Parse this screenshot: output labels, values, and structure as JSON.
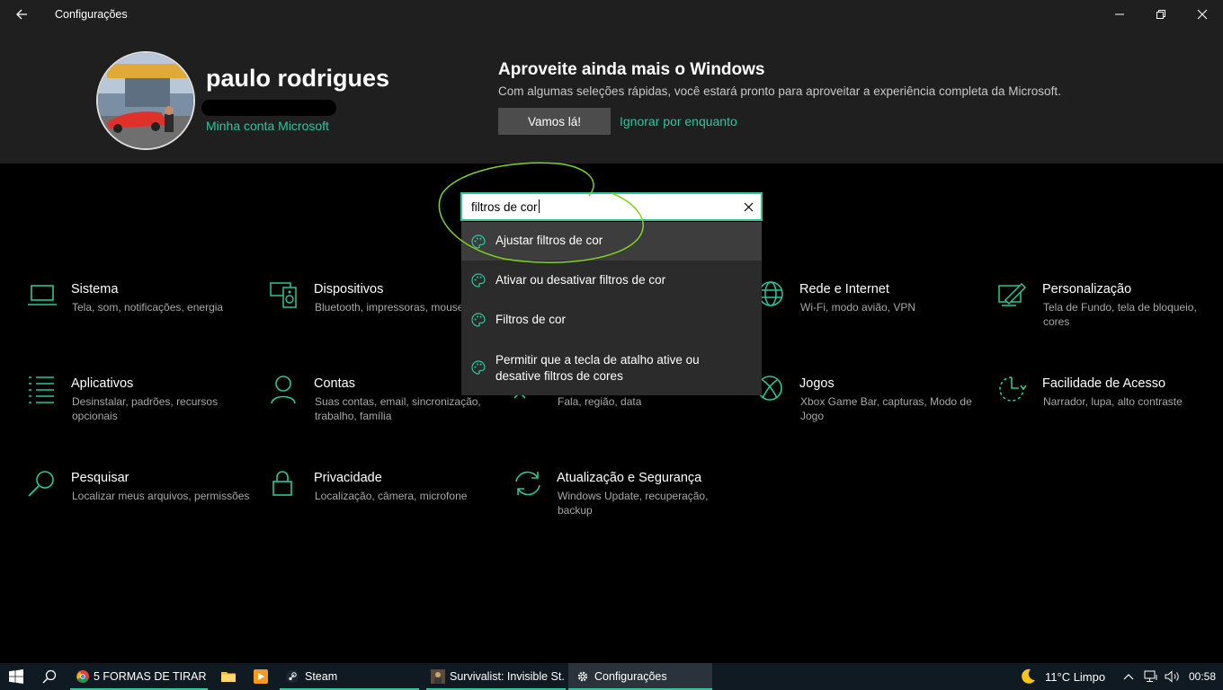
{
  "window": {
    "title": "Configurações",
    "back_icon": "arrow-left-icon",
    "controls": [
      "minimize-icon",
      "maximize-icon",
      "close-icon"
    ]
  },
  "account": {
    "name": "paulo rodrigues",
    "link": "Minha conta Microsoft"
  },
  "promo": {
    "title": "Aproveite ainda mais o Windows",
    "text": "Com algumas seleções rápidas, você estará pronto para aproveitar a experiência completa da Microsoft.",
    "primary_button": "Vamos lá!",
    "secondary_link": "Ignorar por enquanto"
  },
  "search": {
    "value": "filtros de cor",
    "clear_icon": "close-icon",
    "suggestions": [
      {
        "label": "Ajustar filtros de cor",
        "icon": "palette-icon"
      },
      {
        "label": "Ativar ou desativar filtros de cor",
        "icon": "palette-icon"
      },
      {
        "label": "Filtros de cor",
        "icon": "palette-icon"
      },
      {
        "label": "Permitir que a tecla de atalho ative ou desative filtros de cores",
        "icon": "palette-icon"
      }
    ]
  },
  "categories": [
    {
      "title": "Sistema",
      "desc": "Tela, som, notificações, energia",
      "icon": "laptop-icon"
    },
    {
      "title": "Dispositivos",
      "desc": "Bluetooth, impressoras, mouse",
      "icon": "devices-icon"
    },
    {
      "title": "Rede e Internet",
      "desc": "Wi-Fi, modo avião, VPN",
      "icon": "globe-icon"
    },
    {
      "title": "Personalização",
      "desc": "Tela de Fundo, tela de bloqueio, cores",
      "icon": "paint-icon"
    },
    {
      "title": "Aplicativos",
      "desc": "Desinstalar, padrões, recursos opcionais",
      "icon": "apps-list-icon"
    },
    {
      "title": "Contas",
      "desc": "Suas contas, email, sincronização, trabalho, família",
      "icon": "person-icon"
    },
    {
      "title": "",
      "desc": "Fala, região, data",
      "icon": "language-icon"
    },
    {
      "title": "Jogos",
      "desc": "Xbox Game Bar, capturas, Modo de Jogo",
      "icon": "xbox-icon"
    },
    {
      "title": "Facilidade de Acesso",
      "desc": "Narrador, lupa, alto contraste",
      "icon": "ease-of-access-icon"
    },
    {
      "title": "Pesquisar",
      "desc": "Localizar meus arquivos, permissões",
      "icon": "search-icon"
    },
    {
      "title": "Privacidade",
      "desc": "Localização, câmera, microfone",
      "icon": "lock-icon"
    },
    {
      "title": "Atualização e Segurança",
      "desc": "Windows Update, recuperação, backup",
      "icon": "sync-icon"
    }
  ],
  "taskbar": {
    "tasks": [
      {
        "label": "5 FORMAS DE TIRAR ...",
        "icon": "chrome-icon"
      },
      {
        "label": "Steam",
        "icon": "steam-icon"
      },
      {
        "label": "Survivalist: Invisible St...",
        "icon": "game-icon"
      },
      {
        "label": "Configurações",
        "icon": "gear-icon"
      }
    ],
    "weather": "11°C  Limpo",
    "time": "00:58"
  },
  "colors": {
    "accent": "#2cc69a",
    "header_bg": "#1f1f1f",
    "body_bg": "#000000",
    "annotation": "#7ed321"
  }
}
